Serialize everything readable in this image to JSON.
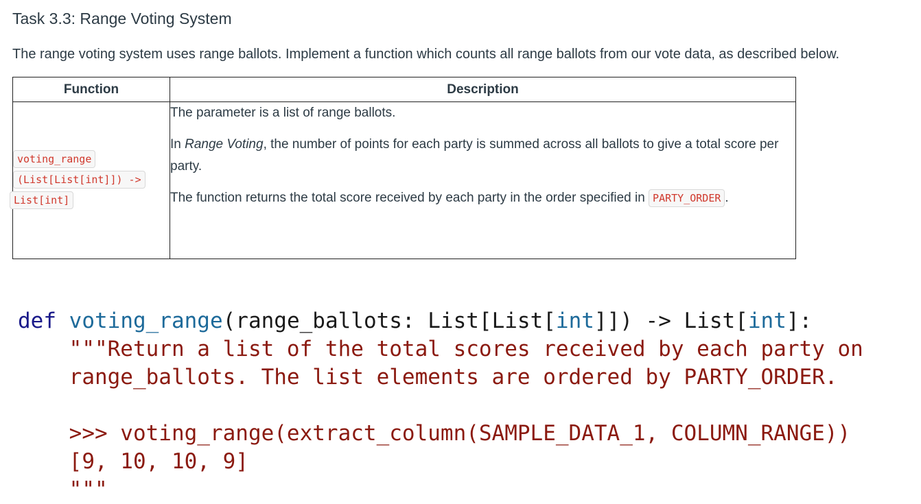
{
  "task": {
    "title": "Task 3.3: Range Voting System",
    "intro": "The range voting system uses range ballots. Implement a function which counts all range ballots from our vote data, as described below."
  },
  "table": {
    "headers": {
      "function": "Function",
      "description": "Description"
    },
    "signature": {
      "name": "voting_range",
      "params": "(List[List[int]]) ->",
      "returns": "List[int]"
    },
    "description": {
      "p1": "The parameter is a list of range ballots.",
      "p2_prefix": "In ",
      "p2_emphasis": "Range Voting",
      "p2_suffix": ", the number of points for each party is summed across all ballots to give a total score per party.",
      "p3_text": "The function returns the total score received by each party in the order specified in ",
      "p3_code": "PARTY_ORDER",
      "p3_end": "."
    }
  },
  "code": {
    "def_kw": "def",
    "fn_name": "voting_range",
    "sig_open": "(range_ballots: List[List[",
    "int1": "int",
    "sig_mid": "]]) -> List[",
    "int2": "int",
    "sig_close": "]:",
    "doc_line1": "\"\"\"Return a list of the total scores received by each party on",
    "doc_line2": "range_ballots. The list elements are ordered by PARTY_ORDER.",
    "doc_line3": "",
    "doc_line4": ">>> voting_range(extract_column(SAMPLE_DATA_1, COLUMN_RANGE))",
    "doc_line5": "[9, 10, 10, 9]",
    "doc_line6": "\"\"\""
  }
}
